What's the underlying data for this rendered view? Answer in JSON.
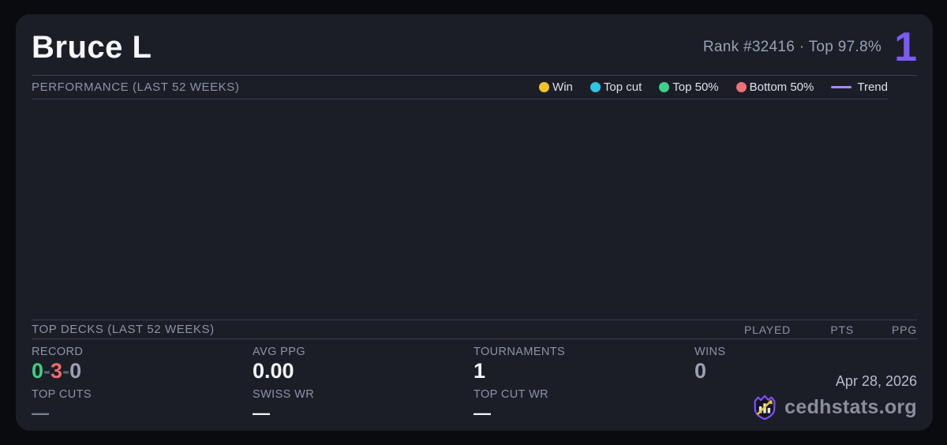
{
  "header": {
    "player_name": "Bruce L",
    "rank_text": "Rank #32416  ·  Top 97.8%",
    "big_rank": "1"
  },
  "performance": {
    "section_title": "PERFORMANCE (LAST 52 WEEKS)",
    "legend": [
      {
        "label": "Win",
        "color": "#f2c424"
      },
      {
        "label": "Top cut",
        "color": "#2bc7e8"
      },
      {
        "label": "Top 50%",
        "color": "#3ecf8e"
      },
      {
        "label": "Bottom 50%",
        "color": "#f0707a"
      },
      {
        "label": "Trend",
        "color": "#a78bfa"
      }
    ]
  },
  "chart_data": {
    "type": "scatter",
    "title": "PERFORMANCE (LAST 52 WEEKS)",
    "x": [],
    "series": [],
    "note": "chart area is empty (no plotted points visible)"
  },
  "top_decks": {
    "section_title": "TOP DECKS (LAST 52 WEEKS)",
    "columns": [
      "PLAYED",
      "PTS",
      "PPG"
    ],
    "rows": []
  },
  "stats": {
    "record": {
      "label": "RECORD",
      "wins": "0",
      "losses": "3",
      "draws": "0",
      "separator": "-"
    },
    "avg_ppg": {
      "label": "AVG PPG",
      "value": "0.00"
    },
    "tournaments": {
      "label": "TOURNAMENTS",
      "value": "1"
    },
    "wins": {
      "label": "WINS",
      "value": "0"
    },
    "top_cuts": {
      "label": "TOP CUTS",
      "value": "—"
    },
    "swiss_wr": {
      "label": "SWISS WR",
      "value": "—"
    },
    "top_cut_wr": {
      "label": "TOP CUT WR",
      "value": "—"
    }
  },
  "footer": {
    "date": "Apr 28, 2026",
    "brand": "cedhstats.org"
  },
  "colors": {
    "page_bg": "#0a0b0e",
    "card_bg": "#1b1e27",
    "divider": "#3a4154",
    "accent_purple": "#7b5bf5",
    "record_win_green": "#3fd07f",
    "record_loss_red": "#ee6b6e",
    "muted_gray": "#8c93a8",
    "logo_purple": "#7c4dff",
    "logo_arrow_yellow": "#f5c71a"
  }
}
